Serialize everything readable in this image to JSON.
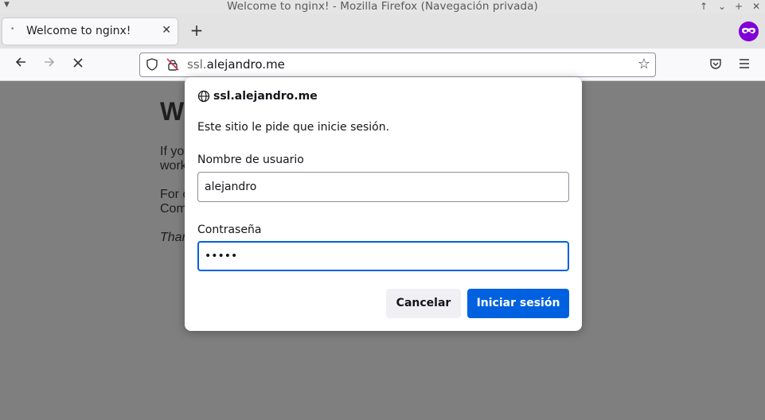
{
  "window": {
    "title": "Welcome to nginx! - Mozilla Firefox (Navegación privada)"
  },
  "tabs": [
    {
      "label": "Welcome to nginx!"
    }
  ],
  "navbar": {
    "url_prefix": "ssl.",
    "url_domain": "alejandro.me"
  },
  "page": {
    "heading": "W",
    "lines": [
      "If yo",
      "work",
      "For o",
      "Com",
      "Than"
    ]
  },
  "dialog": {
    "host": "ssl.alejandro.me",
    "message": "Este sitio le pide que inicie sesión.",
    "username_label": "Nombre de usuario",
    "username_value": "alejandro",
    "password_label": "Contraseña",
    "password_value": "•••••",
    "cancel_label": "Cancelar",
    "submit_label": "Iniciar sesión"
  },
  "colors": {
    "accent": "#0061e0",
    "private": "#8000d7",
    "overlay": "#7f7f7f"
  }
}
